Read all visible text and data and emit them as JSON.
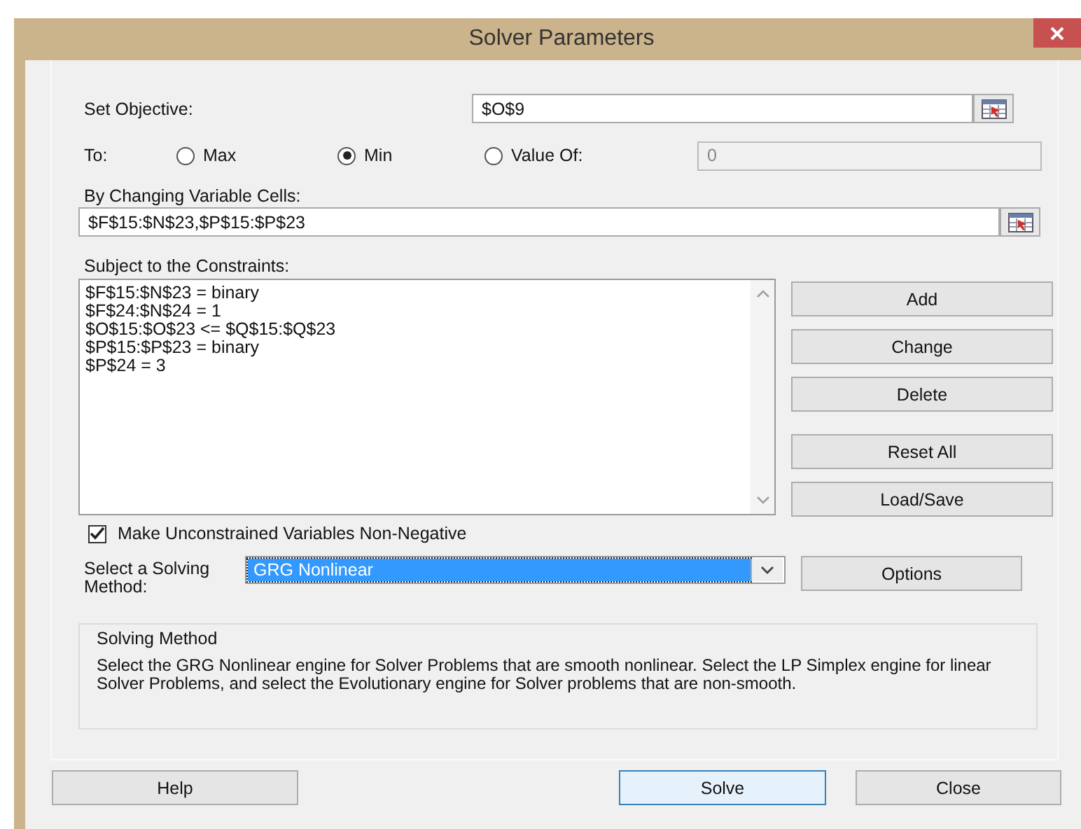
{
  "window": {
    "title": "Solver Parameters"
  },
  "objective": {
    "label": "Set Objective:",
    "value": "$O$9"
  },
  "to": {
    "label": "To:",
    "options": [
      {
        "label": "Max",
        "selected": false
      },
      {
        "label": "Min",
        "selected": true
      },
      {
        "label": "Value Of:",
        "selected": false
      }
    ],
    "value_field": {
      "value": "0",
      "disabled": true
    }
  },
  "changing_cells": {
    "label": "By Changing Variable Cells:",
    "value": "$F$15:$N$23,$P$15:$P$23"
  },
  "constraints": {
    "label": "Subject to the Constraints:",
    "items": [
      "$F$15:$N$23 = binary",
      "$F$24:$N$24 = 1",
      "$O$15:$O$23 <= $Q$15:$Q$23",
      "$P$15:$P$23 = binary",
      "$P$24 = 3"
    ],
    "buttons": [
      "Add",
      "Change",
      "Delete",
      "Reset All",
      "Load/Save"
    ]
  },
  "non_negative": {
    "label": "Make Unconstrained Variables Non-Negative",
    "checked": true
  },
  "solving_method": {
    "label": "Select a Solving Method:",
    "value": "GRG Nonlinear",
    "options_button": "Options"
  },
  "description": {
    "title": "Solving Method",
    "text": "Select the GRG Nonlinear engine for Solver Problems that are smooth nonlinear. Select the LP Simplex engine for linear Solver Problems, and select the Evolutionary engine for Solver problems that are non-smooth."
  },
  "buttons": [
    {
      "label": "Help",
      "focused": false
    },
    {
      "label": "Solve",
      "focused": true
    },
    {
      "label": "Close",
      "focused": false
    }
  ]
}
